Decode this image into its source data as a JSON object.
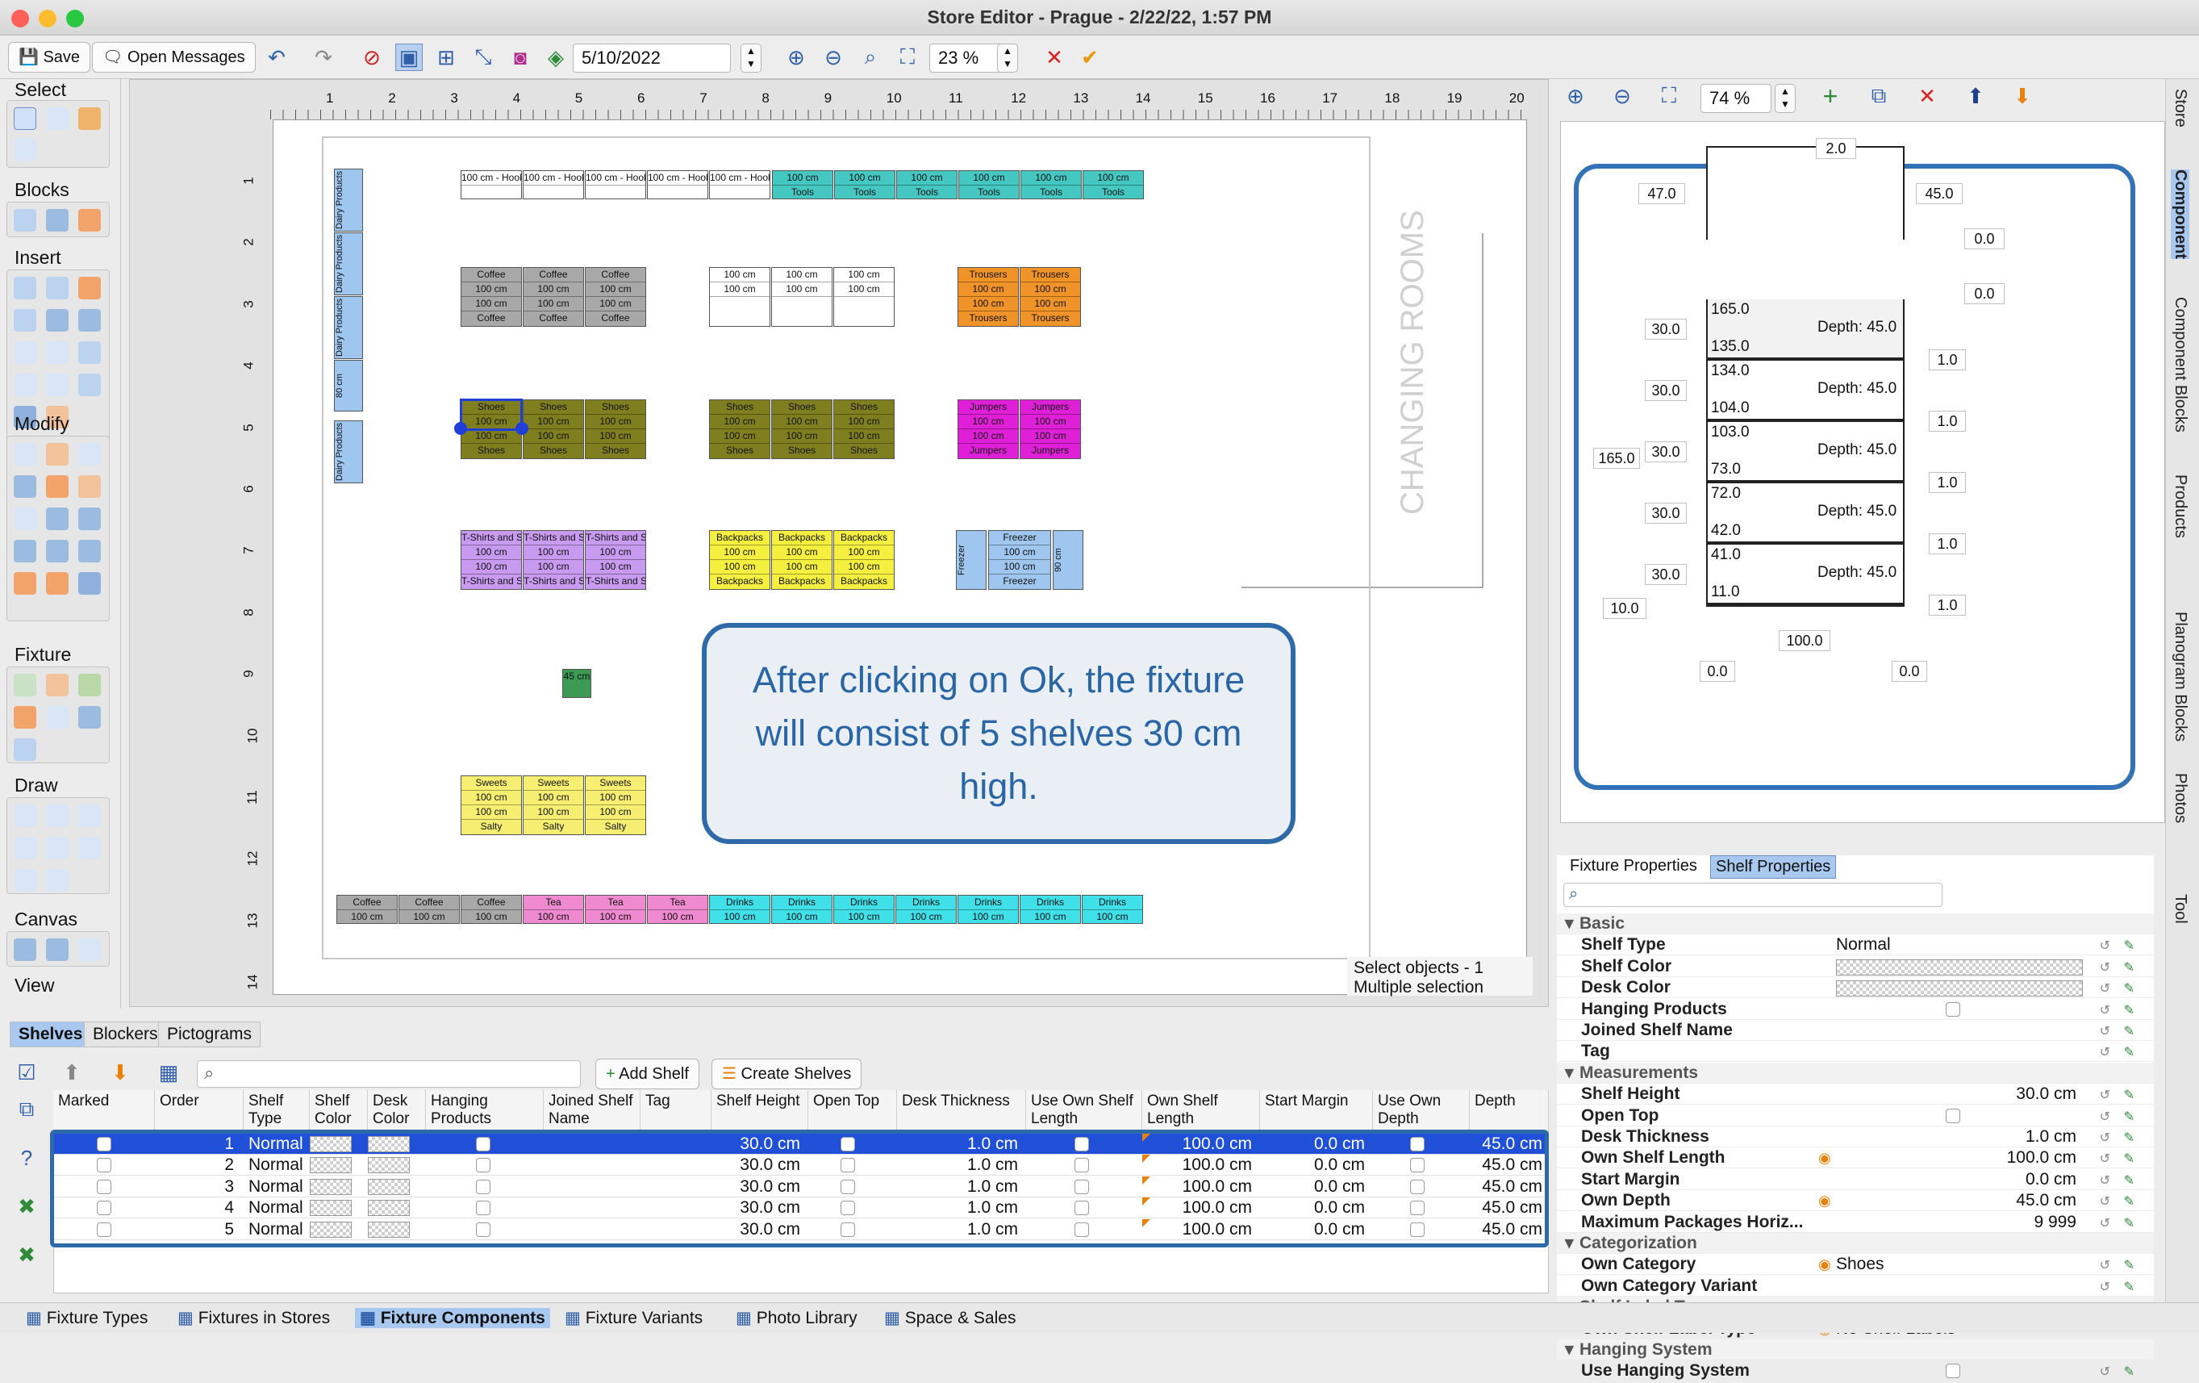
{
  "window": {
    "title": "Store Editor - Prague - 2/22/22, 1:57 PM"
  },
  "toolbar": {
    "save_label": "Save",
    "messages_label": "Open Messages",
    "date_value": "5/10/2022",
    "zoom_value": "23 %"
  },
  "palette": {
    "sections": [
      "Select",
      "Blocks",
      "Insert",
      "Modify",
      "Fixture",
      "Draw",
      "Canvas",
      "View"
    ]
  },
  "ruler": {
    "top": [
      "1",
      "2",
      "3",
      "4",
      "5",
      "6",
      "7",
      "8",
      "9",
      "10",
      "11",
      "12",
      "13",
      "14",
      "15",
      "16",
      "17",
      "18",
      "19",
      "20"
    ],
    "left": [
      "1",
      "2",
      "3",
      "4",
      "5",
      "6",
      "7",
      "8",
      "9",
      "10",
      "11",
      "12",
      "13",
      "14"
    ]
  },
  "plan": {
    "hooks": [
      "100 cm - Hook1",
      "100 cm - Hook2",
      "100 cm - Hook3",
      "100 cm - Hook4",
      "100 cm - Hook5"
    ],
    "tools": [
      "100 cm",
      "Tools"
    ],
    "dairy": [
      "100 cm",
      "Dairy Products",
      "80 cm",
      "Dairy Products"
    ],
    "coffee_block": [
      "Coffee",
      "100 cm",
      "100 cm",
      "Coffee"
    ],
    "white_block": [
      "100 cm",
      "100 cm"
    ],
    "trousers_block": [
      "Trousers",
      "100 cm",
      "100 cm",
      "Trousers"
    ],
    "shoes_block": [
      "Shoes",
      "100 cm",
      "100 cm",
      "Shoes"
    ],
    "jumpers_block": [
      "Jumpers",
      "100 cm",
      "100 cm",
      "Jumpers"
    ],
    "tshirt_block": [
      "T-Shirts and Shirts",
      "100 cm",
      "100 cm",
      "T-Shirts and Shirts"
    ],
    "backpacks_block": [
      "Backpacks",
      "100 cm",
      "100 cm",
      "Backpacks"
    ],
    "freezer_block": [
      "Freezer",
      "100 cm",
      "100 cm",
      "Freezer",
      "90 cm",
      "Freezer"
    ],
    "small_block": "45 cm",
    "sweets_block": [
      "Sweets",
      "100 cm",
      "100 cm",
      "Salty"
    ],
    "bottom_row": [
      [
        "Coffee",
        "100 cm"
      ],
      [
        "Coffee",
        "100 cm"
      ],
      [
        "Coffee",
        "100 cm"
      ],
      [
        "Tea",
        "100 cm"
      ],
      [
        "Tea",
        "100 cm"
      ],
      [
        "Tea",
        "100 cm"
      ],
      [
        "Drinks",
        "100 cm"
      ],
      [
        "Drinks",
        "100 cm"
      ],
      [
        "Drinks",
        "100 cm"
      ],
      [
        "Drinks",
        "100 cm"
      ],
      [
        "Drinks",
        "100 cm"
      ],
      [
        "Drinks",
        "100 cm"
      ],
      [
        "Drinks",
        "100 cm"
      ]
    ],
    "changing_rooms": "CHANGING ROOMS"
  },
  "callout": {
    "text": "After clicking on Ok, the fixture will consist of 5 shelves 30 cm high."
  },
  "selection_info": {
    "line1": "Select objects - 1",
    "line2": "Multiple selection"
  },
  "fixture_view": {
    "zoom_value": "74 %",
    "top_right": "2.0",
    "left_top": "47.0",
    "right_top": "45.0",
    "right_zero1": "0.0",
    "right_zero2": "0.0",
    "shelves": [
      {
        "top": "165.0",
        "bottom": "135.0",
        "depth": "Depth: 45.0",
        "height": "30.0",
        "thick": "1.0"
      },
      {
        "top": "134.0",
        "bottom": "104.0",
        "depth": "Depth: 45.0",
        "height": "30.0",
        "thick": "1.0"
      },
      {
        "top": "103.0",
        "bottom": "73.0",
        "depth": "Depth: 45.0",
        "height": "30.0",
        "thick": "1.0"
      },
      {
        "top": "72.0",
        "bottom": "42.0",
        "depth": "Depth: 45.0",
        "height": "30.0",
        "thick": "1.0"
      },
      {
        "top": "41.0",
        "bottom": "11.0",
        "depth": "Depth: 45.0",
        "height": "30.0",
        "thick": "1.0"
      }
    ],
    "total_height": "165.0",
    "base": "10.0",
    "width": "100.0",
    "bottom_left": "0.0",
    "bottom_right": "0.0"
  },
  "side_tabs": [
    "Store",
    "Component",
    "Component Blocks",
    "Products",
    "Planogram Blocks",
    "Photos",
    "Tool"
  ],
  "props_tabs": {
    "fixture": "Fixture Properties",
    "shelf": "Shelf Properties"
  },
  "props": [
    {
      "section": "Basic"
    },
    {
      "key": "Shelf Type",
      "value": "Normal"
    },
    {
      "key": "Shelf Color",
      "value": ""
    },
    {
      "key": "Desk Color",
      "value": ""
    },
    {
      "key": "Hanging Products",
      "value": ""
    },
    {
      "key": "Joined Shelf Name",
      "value": ""
    },
    {
      "key": "Tag",
      "value": ""
    },
    {
      "section": "Measurements"
    },
    {
      "key": "Shelf Height",
      "value": "30.0 cm"
    },
    {
      "key": "Open Top",
      "value": ""
    },
    {
      "key": "Desk Thickness",
      "value": "1.0 cm"
    },
    {
      "key": "Own Shelf Length",
      "value": "100.0 cm"
    },
    {
      "key": "Start Margin",
      "value": "0.0 cm"
    },
    {
      "key": "Own Depth",
      "value": "45.0 cm"
    },
    {
      "key": "Maximum Packages Horiz...",
      "value": "9 999"
    },
    {
      "section": "Categorization"
    },
    {
      "key": "Own Category",
      "value": "Shoes"
    },
    {
      "key": "Own Category Variant",
      "value": ""
    },
    {
      "section": "Shelf Label Types"
    },
    {
      "key": "Own Shelf Label Type",
      "value": "No Shelf Labels"
    },
    {
      "section": "Hanging System"
    },
    {
      "key": "Use Hanging System",
      "value": ""
    }
  ],
  "bottom_tabs": {
    "shelves": "Shelves",
    "blockers": "Blockers",
    "pictograms": "Pictograms"
  },
  "bottom_buttons": {
    "add_shelf": "Add Shelf",
    "create_shelves": "Create Shelves"
  },
  "table": {
    "headers": [
      "Marked",
      "Order",
      "Shelf Type",
      "Shelf Color",
      "Desk Color",
      "Hanging Products",
      "Joined Shelf Name",
      "Tag",
      "Shelf Height",
      "Open Top",
      "Desk Thickness",
      "Use Own Shelf Length",
      "Own Shelf Length",
      "Start Margin",
      "Use Own Depth",
      "Depth"
    ],
    "rows": [
      {
        "order": "1",
        "type": "Normal",
        "height": "30.0 cm",
        "thick": "1.0 cm",
        "length": "100.0 cm",
        "margin": "0.0 cm",
        "depth": "45.0 cm"
      },
      {
        "order": "2",
        "type": "Normal",
        "height": "30.0 cm",
        "thick": "1.0 cm",
        "length": "100.0 cm",
        "margin": "0.0 cm",
        "depth": "45.0 cm"
      },
      {
        "order": "3",
        "type": "Normal",
        "height": "30.0 cm",
        "thick": "1.0 cm",
        "length": "100.0 cm",
        "margin": "0.0 cm",
        "depth": "45.0 cm"
      },
      {
        "order": "4",
        "type": "Normal",
        "height": "30.0 cm",
        "thick": "1.0 cm",
        "length": "100.0 cm",
        "margin": "0.0 cm",
        "depth": "45.0 cm"
      },
      {
        "order": "5",
        "type": "Normal",
        "height": "30.0 cm",
        "thick": "1.0 cm",
        "length": "100.0 cm",
        "margin": "0.0 cm",
        "depth": "45.0 cm"
      }
    ]
  },
  "status_tabs": [
    "Fixture Types",
    "Fixtures in Stores",
    "Fixture Components",
    "Fixture Variants",
    "Photo Library",
    "Space & Sales"
  ],
  "colors": {
    "accent": "#2f6aa8",
    "selection": "#2050d8"
  }
}
